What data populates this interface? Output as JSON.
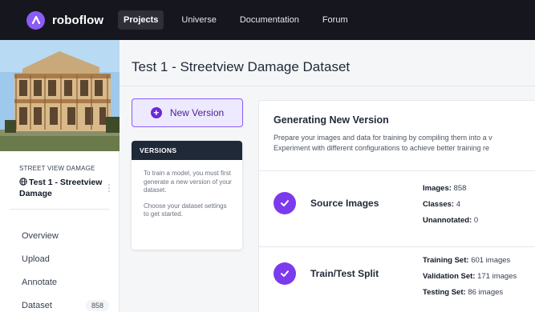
{
  "brand": {
    "name": "roboflow",
    "accent": "#8b5cf6"
  },
  "nav": {
    "items": [
      {
        "label": "Projects",
        "active": true
      },
      {
        "label": "Universe",
        "active": false
      },
      {
        "label": "Documentation",
        "active": false
      },
      {
        "label": "Forum",
        "active": false
      }
    ]
  },
  "sidebar": {
    "project_type": "STREET VIEW DAMAGE",
    "project_name": "Test 1 - Streetview Damage",
    "project_icon": "globe-icon",
    "menu": [
      {
        "label": "Overview"
      },
      {
        "label": "Upload"
      },
      {
        "label": "Annotate"
      },
      {
        "label": "Dataset",
        "count": "858"
      }
    ]
  },
  "main": {
    "title": "Test 1 - Streetview Damage Dataset",
    "new_version_label": "New Version",
    "versions": {
      "header": "VERSIONS",
      "body_1": "To train a model, you must first generate a new version of your dataset.",
      "body_2": "Choose your dataset settings to get started."
    },
    "generating": {
      "title": "Generating New Version",
      "desc_1": "Prepare your images and data for training by compiling them into a v",
      "desc_2": "Experiment with different configurations to achieve better training re",
      "steps": [
        {
          "name": "Source Images",
          "details": [
            {
              "label": "Images:",
              "value": "858"
            },
            {
              "label": "Classes:",
              "value": "4"
            },
            {
              "label": "Unannotated:",
              "value": "0"
            }
          ]
        },
        {
          "name": "Train/Test Split",
          "details": [
            {
              "label": "Training Set:",
              "value": "601 images"
            },
            {
              "label": "Validation Set:",
              "value": "171 images"
            },
            {
              "label": "Testing Set:",
              "value": "86 images"
            }
          ]
        }
      ]
    }
  }
}
